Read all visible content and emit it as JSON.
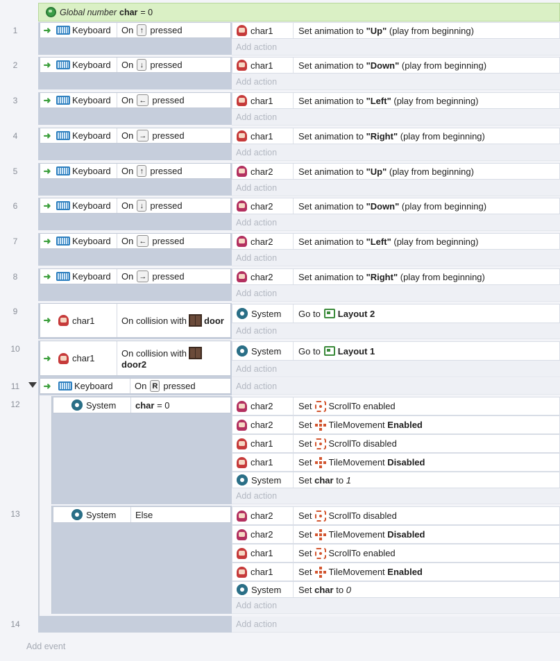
{
  "global": {
    "prefix": "Global number",
    "name": "char",
    "rest": "= 0"
  },
  "events": [
    {
      "n": "1",
      "obj": "Keyboard",
      "on": "On",
      "key": "↑",
      "pressed": "pressed",
      "a_obj": "char1",
      "a_pre": "Set animation to",
      "a_val": "\"Up\"",
      "a_post": "(play from beginning)"
    },
    {
      "n": "2",
      "obj": "Keyboard",
      "on": "On",
      "key": "↓",
      "pressed": "pressed",
      "a_obj": "char1",
      "a_pre": "Set animation to",
      "a_val": "\"Down\"",
      "a_post": "(play from beginning)"
    },
    {
      "n": "3",
      "obj": "Keyboard",
      "on": "On",
      "key": "←",
      "pressed": "pressed",
      "a_obj": "char1",
      "a_pre": "Set animation to",
      "a_val": "\"Left\"",
      "a_post": "(play from beginning)"
    },
    {
      "n": "4",
      "obj": "Keyboard",
      "on": "On",
      "key": "→",
      "pressed": "pressed",
      "a_obj": "char1",
      "a_pre": "Set animation to",
      "a_val": "\"Right\"",
      "a_post": "(play from beginning)"
    },
    {
      "n": "5",
      "obj": "Keyboard",
      "on": "On",
      "key": "↑",
      "pressed": "pressed",
      "a_obj": "char2",
      "a_pre": "Set animation to",
      "a_val": "\"Up\"",
      "a_post": "(play from beginning)"
    },
    {
      "n": "6",
      "obj": "Keyboard",
      "on": "On",
      "key": "↓",
      "pressed": "pressed",
      "a_obj": "char2",
      "a_pre": "Set animation to",
      "a_val": "\"Down\"",
      "a_post": "(play from beginning)"
    },
    {
      "n": "7",
      "obj": "Keyboard",
      "on": "On",
      "key": "←",
      "pressed": "pressed",
      "a_obj": "char2",
      "a_pre": "Set animation to",
      "a_val": "\"Left\"",
      "a_post": "(play from beginning)"
    },
    {
      "n": "8",
      "obj": "Keyboard",
      "on": "On",
      "key": "→",
      "pressed": "pressed",
      "a_obj": "char2",
      "a_pre": "Set animation to",
      "a_val": "\"Right\"",
      "a_post": "(play from beginning)"
    }
  ],
  "collisions": [
    {
      "n": "9",
      "obj": "char1",
      "cond": "On collision with",
      "target": "door",
      "a_obj": "System",
      "a_pre": "Go to",
      "a_val": "Layout 2"
    },
    {
      "n": "10",
      "obj": "char1",
      "cond": "On collision with",
      "target": "door2",
      "a_obj": "System",
      "a_pre": "Go to",
      "a_val": "Layout 1"
    }
  ],
  "ev11": {
    "n": "11",
    "obj": "Keyboard",
    "on": "On",
    "key": "R",
    "pressed": "pressed"
  },
  "ev12": {
    "n": "12",
    "obj": "System",
    "var": "char",
    "cmp": "= 0",
    "actions": [
      {
        "obj": "char2",
        "set": "Set",
        "beh": "ScrollTo",
        "state": "enabled",
        "bold": false
      },
      {
        "obj": "char2",
        "set": "Set",
        "beh": "TileMovement",
        "state": "Enabled",
        "bold": true
      },
      {
        "obj": "char1",
        "set": "Set",
        "beh": "ScrollTo",
        "state": "disabled",
        "bold": false
      },
      {
        "obj": "char1",
        "set": "Set",
        "beh": "TileMovement",
        "state": "Disabled",
        "bold": true
      }
    ],
    "sys": {
      "obj": "System",
      "set": "Set",
      "var": "char",
      "to": "to",
      "val": "1"
    }
  },
  "ev13": {
    "n": "13",
    "obj": "System",
    "cond": "Else",
    "actions": [
      {
        "obj": "char2",
        "set": "Set",
        "beh": "ScrollTo",
        "state": "disabled",
        "bold": false
      },
      {
        "obj": "char2",
        "set": "Set",
        "beh": "TileMovement",
        "state": "Disabled",
        "bold": true
      },
      {
        "obj": "char1",
        "set": "Set",
        "beh": "ScrollTo",
        "state": "enabled",
        "bold": false
      },
      {
        "obj": "char1",
        "set": "Set",
        "beh": "TileMovement",
        "state": "Enabled",
        "bold": true
      }
    ],
    "sys": {
      "obj": "System",
      "set": "Set",
      "var": "char",
      "to": "to",
      "val": "0"
    }
  },
  "ev14": {
    "n": "14"
  },
  "add_action": "Add action",
  "add_event": "Add event"
}
